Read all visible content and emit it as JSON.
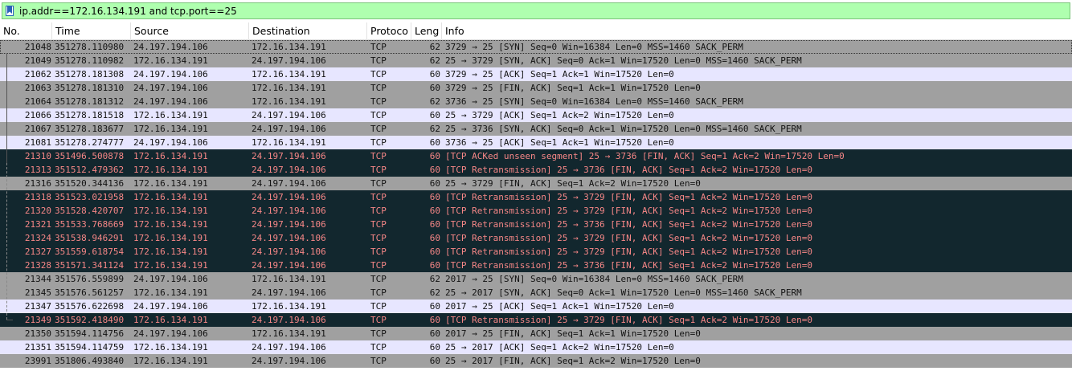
{
  "filter": {
    "value": "ip.addr==172.16.134.191 and tcp.port==25"
  },
  "colors": {
    "filter_bg": "#afffaf",
    "row_grey": "#a0a0a0",
    "row_light": "#e7e6ff",
    "row_dark": "#12272e",
    "dark_text": "#f78787"
  },
  "columns": [
    "No.",
    "Time",
    "Source",
    "Destination",
    "Protoco",
    "Leng",
    "Info"
  ],
  "packets": [
    {
      "no": "21048",
      "time": "351278.110980",
      "src": "24.197.194.106",
      "dst": "172.16.134.191",
      "proto": "TCP",
      "len": "62",
      "info": "3729 → 25 [SYN] Seq=0 Win=16384 Len=0 MSS=1460 SACK_PERM",
      "style": "selected"
    },
    {
      "no": "21049",
      "time": "351278.110982",
      "src": "172.16.134.191",
      "dst": "24.197.194.106",
      "proto": "TCP",
      "len": "62",
      "info": "25 → 3729 [SYN, ACK] Seq=0 Ack=1 Win=17520 Len=0 MSS=1460 SACK_PERM",
      "style": "grey"
    },
    {
      "no": "21062",
      "time": "351278.181308",
      "src": "24.197.194.106",
      "dst": "172.16.134.191",
      "proto": "TCP",
      "len": "60",
      "info": "3729 → 25 [ACK] Seq=1 Ack=1 Win=17520 Len=0",
      "style": "light"
    },
    {
      "no": "21063",
      "time": "351278.181310",
      "src": "24.197.194.106",
      "dst": "172.16.134.191",
      "proto": "TCP",
      "len": "60",
      "info": "3729 → 25 [FIN, ACK] Seq=1 Ack=1 Win=17520 Len=0",
      "style": "grey"
    },
    {
      "no": "21064",
      "time": "351278.181312",
      "src": "24.197.194.106",
      "dst": "172.16.134.191",
      "proto": "TCP",
      "len": "62",
      "info": "3736 → 25 [SYN] Seq=0 Win=16384 Len=0 MSS=1460 SACK_PERM",
      "style": "grey"
    },
    {
      "no": "21066",
      "time": "351278.181518",
      "src": "172.16.134.191",
      "dst": "24.197.194.106",
      "proto": "TCP",
      "len": "60",
      "info": "25 → 3729 [ACK] Seq=1 Ack=2 Win=17520 Len=0",
      "style": "light"
    },
    {
      "no": "21067",
      "time": "351278.183677",
      "src": "172.16.134.191",
      "dst": "24.197.194.106",
      "proto": "TCP",
      "len": "62",
      "info": "25 → 3736 [SYN, ACK] Seq=0 Ack=1 Win=17520 Len=0 MSS=1460 SACK_PERM",
      "style": "grey"
    },
    {
      "no": "21081",
      "time": "351278.274777",
      "src": "24.197.194.106",
      "dst": "172.16.134.191",
      "proto": "TCP",
      "len": "60",
      "info": "3736 → 25 [ACK] Seq=1 Ack=1 Win=17520 Len=0",
      "style": "light"
    },
    {
      "no": "21310",
      "time": "351496.500878",
      "src": "172.16.134.191",
      "dst": "24.197.194.106",
      "proto": "TCP",
      "len": "60",
      "info": "[TCP ACKed unseen segment] 25 → 3736 [FIN, ACK] Seq=1 Ack=2 Win=17520 Len=0",
      "style": "dark"
    },
    {
      "no": "21313",
      "time": "351512.479362",
      "src": "172.16.134.191",
      "dst": "24.197.194.106",
      "proto": "TCP",
      "len": "60",
      "info": "[TCP Retransmission] 25 → 3736 [FIN, ACK] Seq=1 Ack=2 Win=17520 Len=0",
      "style": "dark"
    },
    {
      "no": "21316",
      "time": "351520.344136",
      "src": "172.16.134.191",
      "dst": "24.197.194.106",
      "proto": "TCP",
      "len": "60",
      "info": "25 → 3729 [FIN, ACK] Seq=1 Ack=2 Win=17520 Len=0",
      "style": "grey"
    },
    {
      "no": "21318",
      "time": "351523.021958",
      "src": "172.16.134.191",
      "dst": "24.197.194.106",
      "proto": "TCP",
      "len": "60",
      "info": "[TCP Retransmission] 25 → 3729 [FIN, ACK] Seq=1 Ack=2 Win=17520 Len=0",
      "style": "dark"
    },
    {
      "no": "21320",
      "time": "351528.420707",
      "src": "172.16.134.191",
      "dst": "24.197.194.106",
      "proto": "TCP",
      "len": "60",
      "info": "[TCP Retransmission] 25 → 3729 [FIN, ACK] Seq=1 Ack=2 Win=17520 Len=0",
      "style": "dark"
    },
    {
      "no": "21321",
      "time": "351533.768669",
      "src": "172.16.134.191",
      "dst": "24.197.194.106",
      "proto": "TCP",
      "len": "60",
      "info": "[TCP Retransmission] 25 → 3736 [FIN, ACK] Seq=1 Ack=2 Win=17520 Len=0",
      "style": "dark"
    },
    {
      "no": "21324",
      "time": "351538.946291",
      "src": "172.16.134.191",
      "dst": "24.197.194.106",
      "proto": "TCP",
      "len": "60",
      "info": "[TCP Retransmission] 25 → 3729 [FIN, ACK] Seq=1 Ack=2 Win=17520 Len=0",
      "style": "dark"
    },
    {
      "no": "21327",
      "time": "351559.618754",
      "src": "172.16.134.191",
      "dst": "24.197.194.106",
      "proto": "TCP",
      "len": "60",
      "info": "[TCP Retransmission] 25 → 3729 [FIN, ACK] Seq=1 Ack=2 Win=17520 Len=0",
      "style": "dark"
    },
    {
      "no": "21328",
      "time": "351571.341124",
      "src": "172.16.134.191",
      "dst": "24.197.194.106",
      "proto": "TCP",
      "len": "60",
      "info": "[TCP Retransmission] 25 → 3736 [FIN, ACK] Seq=1 Ack=2 Win=17520 Len=0",
      "style": "dark"
    },
    {
      "no": "21344",
      "time": "351576.559899",
      "src": "24.197.194.106",
      "dst": "172.16.134.191",
      "proto": "TCP",
      "len": "62",
      "info": "2017 → 25 [SYN] Seq=0 Win=16384 Len=0 MSS=1460 SACK_PERM",
      "style": "grey"
    },
    {
      "no": "21345",
      "time": "351576.561257",
      "src": "172.16.134.191",
      "dst": "24.197.194.106",
      "proto": "TCP",
      "len": "62",
      "info": "25 → 2017 [SYN, ACK] Seq=0 Ack=1 Win=17520 Len=0 MSS=1460 SACK_PERM",
      "style": "grey"
    },
    {
      "no": "21347",
      "time": "351576.622698",
      "src": "24.197.194.106",
      "dst": "172.16.134.191",
      "proto": "TCP",
      "len": "60",
      "info": "2017 → 25 [ACK] Seq=1 Ack=1 Win=17520 Len=0",
      "style": "light"
    },
    {
      "no": "21349",
      "time": "351592.418490",
      "src": "172.16.134.191",
      "dst": "24.197.194.106",
      "proto": "TCP",
      "len": "60",
      "info": "[TCP Retransmission] 25 → 3729 [FIN, ACK] Seq=1 Ack=2 Win=17520 Len=0",
      "style": "dark"
    },
    {
      "no": "21350",
      "time": "351594.114756",
      "src": "24.197.194.106",
      "dst": "172.16.134.191",
      "proto": "TCP",
      "len": "60",
      "info": "2017 → 25 [FIN, ACK] Seq=1 Ack=1 Win=17520 Len=0",
      "style": "grey"
    },
    {
      "no": "21351",
      "time": "351594.114759",
      "src": "172.16.134.191",
      "dst": "24.197.194.106",
      "proto": "TCP",
      "len": "60",
      "info": "25 → 2017 [ACK] Seq=1 Ack=2 Win=17520 Len=0",
      "style": "light"
    },
    {
      "no": "23991",
      "time": "351806.493840",
      "src": "172.16.134.191",
      "dst": "24.197.194.106",
      "proto": "TCP",
      "len": "60",
      "info": "25 → 2017 [FIN, ACK] Seq=1 Ack=2 Win=17520 Len=0",
      "style": "grey"
    }
  ]
}
